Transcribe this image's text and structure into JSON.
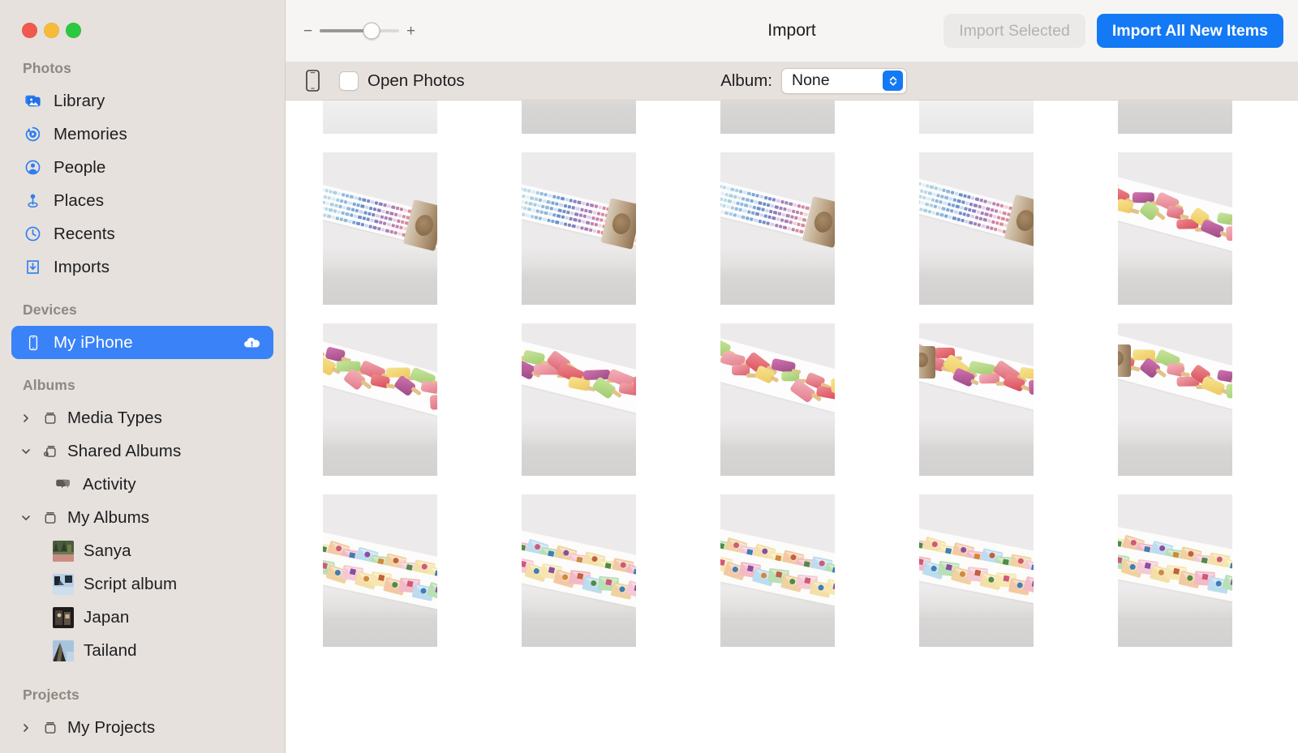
{
  "window": {
    "traffic_lights": [
      "close",
      "minimize",
      "zoom"
    ]
  },
  "sidebar": {
    "sections": [
      {
        "title": "Photos",
        "items": [
          {
            "label": "Library",
            "icon": "library-icon"
          },
          {
            "label": "Memories",
            "icon": "memories-icon"
          },
          {
            "label": "People",
            "icon": "people-icon"
          },
          {
            "label": "Places",
            "icon": "places-icon"
          },
          {
            "label": "Recents",
            "icon": "recents-icon"
          },
          {
            "label": "Imports",
            "icon": "imports-icon"
          }
        ]
      },
      {
        "title": "Devices",
        "items": [
          {
            "label": "My iPhone",
            "icon": "iphone-icon",
            "selected": true,
            "badge": "cloud-exclamation-icon"
          }
        ]
      },
      {
        "title": "Albums",
        "items": [
          {
            "label": "Media Types",
            "icon": "album-folder-icon",
            "disclosure": "collapsed"
          },
          {
            "label": "Shared Albums",
            "icon": "shared-album-icon",
            "disclosure": "expanded"
          },
          {
            "label": "Activity",
            "icon": "activity-icon",
            "indent": 1
          },
          {
            "label": "My Albums",
            "icon": "album-folder-icon",
            "disclosure": "expanded"
          },
          {
            "label": "Sanya",
            "icon": "album-thumb",
            "indent": 1
          },
          {
            "label": "Script album",
            "icon": "album-thumb",
            "indent": 1
          },
          {
            "label": "Japan",
            "icon": "album-thumb",
            "indent": 1
          },
          {
            "label": "Tailand",
            "icon": "album-thumb",
            "indent": 1
          }
        ]
      },
      {
        "title": "Projects",
        "items": [
          {
            "label": "My Projects",
            "icon": "album-folder-icon",
            "disclosure": "collapsed"
          }
        ]
      }
    ]
  },
  "toolbar": {
    "title": "Import",
    "zoom_minus": "−",
    "zoom_plus": "+",
    "zoom_value": 65,
    "import_selected_label": "Import Selected",
    "import_selected_enabled": false,
    "import_all_label": "Import All New Items",
    "accent_color": "#1379f4"
  },
  "import_bar": {
    "device_icon": "iphone-icon",
    "open_photos_label": "Open Photos",
    "open_photos_checked": false,
    "album_label": "Album:",
    "album_value": "None"
  },
  "grid": {
    "columns": 5,
    "rows": [
      {
        "kind": "leaf-tape",
        "cells": [
          {
            "tape": "leaf",
            "bg": "bright",
            "roll": false
          },
          {
            "tape": "leaf",
            "bg": "normal",
            "roll": true
          },
          {
            "tape": "dots",
            "bg": "normal",
            "roll": true
          },
          {
            "tape": "dots",
            "bg": "bright",
            "roll": true
          },
          {
            "tape": "dots",
            "bg": "normal",
            "roll": true
          }
        ]
      },
      {
        "kind": "dot-tape",
        "cells": [
          {
            "tape": "dots",
            "bg": "normal",
            "roll": true
          },
          {
            "tape": "dots",
            "bg": "normal",
            "roll": true
          },
          {
            "tape": "dots",
            "bg": "normal",
            "roll": true
          },
          {
            "tape": "dots",
            "bg": "normal",
            "roll": true
          },
          {
            "tape": "pop",
            "bg": "normal",
            "roll": false
          }
        ]
      },
      {
        "kind": "popsicle-tape",
        "cells": [
          {
            "tape": "pop",
            "bg": "normal",
            "roll": false
          },
          {
            "tape": "pop",
            "bg": "normal",
            "roll": false
          },
          {
            "tape": "pop",
            "bg": "normal",
            "roll": false
          },
          {
            "tape": "pop",
            "bg": "normal",
            "roll": true
          },
          {
            "tape": "pop",
            "bg": "normal",
            "roll": true
          }
        ]
      },
      {
        "kind": "envelope-tape",
        "cells": [
          {
            "tape": "env",
            "bg": "normal",
            "roll": false
          },
          {
            "tape": "env",
            "bg": "normal",
            "roll": false
          },
          {
            "tape": "env",
            "bg": "normal",
            "roll": false
          },
          {
            "tape": "env",
            "bg": "normal",
            "roll": false
          },
          {
            "tape": "env",
            "bg": "normal",
            "roll": false
          }
        ]
      }
    ]
  }
}
